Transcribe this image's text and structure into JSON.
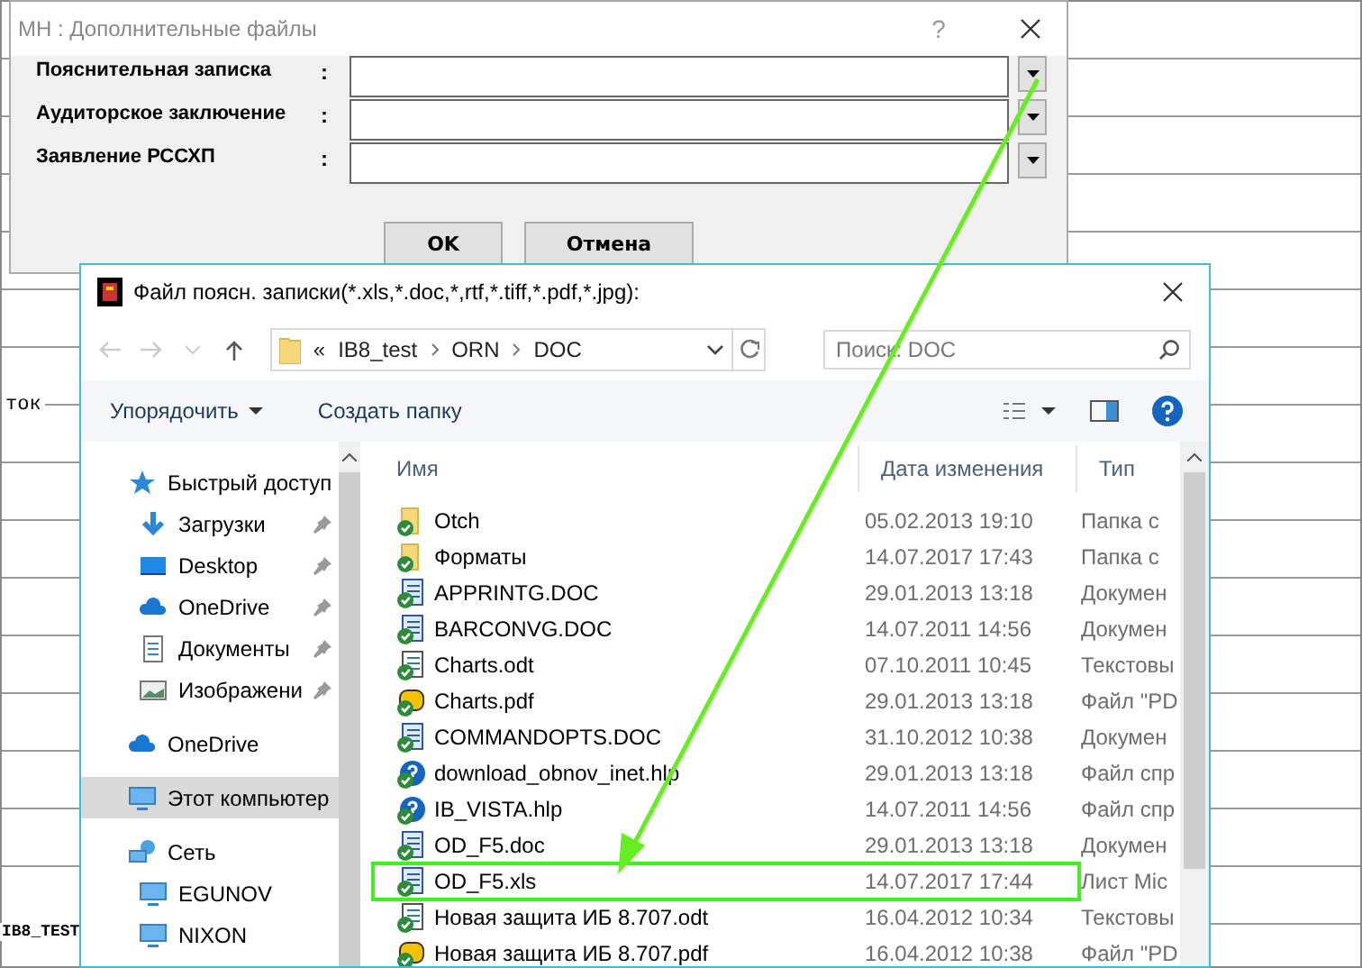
{
  "background_window": {
    "texts": [
      "ток",
      "IB8_TEST"
    ]
  },
  "dialog": {
    "title": "МН : Дополнительные файлы",
    "help": "?",
    "fields": [
      {
        "label": "Пояснительная записка",
        "separator": ":"
      },
      {
        "label": "Аудиторское заключение",
        "separator": ":"
      },
      {
        "label": "Заявление РССХП",
        "separator": ":"
      }
    ],
    "buttons": [
      {
        "label": "OK"
      },
      {
        "label": "Отмена"
      }
    ]
  },
  "file_dialog": {
    "title": "Файл поясн. записки(*.xls,*.doc,*,rtf,*.tiff,*.pdf,*.jpg):",
    "breadcrumb": {
      "overflow": "«",
      "segments": [
        "IB8_test",
        "ORN",
        "DOC"
      ]
    },
    "search": {
      "placeholder": "Поиск: DOC"
    },
    "toolbar": {
      "organize": "Упорядочить",
      "new_folder": "Создать папку"
    },
    "sidebar": [
      {
        "label": "Быстрый доступ",
        "kind": "star",
        "selected": false,
        "children": [
          {
            "label": "Загрузки",
            "kind": "download",
            "pinned": true,
            "selected": false
          },
          {
            "label": "Desktop",
            "kind": "desktop",
            "pinned": true,
            "selected": false
          },
          {
            "label": "OneDrive",
            "kind": "cloud",
            "pinned": true,
            "selected": false
          },
          {
            "label": "Документы",
            "kind": "document",
            "pinned": true,
            "selected": false
          },
          {
            "label": "Изображени",
            "kind": "image",
            "pinned": true,
            "selected": false
          }
        ]
      },
      {
        "label": "OneDrive",
        "kind": "cloud",
        "selected": false
      },
      {
        "label": "Этот компьютер",
        "kind": "computer",
        "selected": true
      },
      {
        "label": "Сеть",
        "kind": "network",
        "selected": false,
        "children": [
          {
            "label": "EGUNOV",
            "kind": "computer",
            "pinned": false,
            "selected": false
          },
          {
            "label": "NIXON",
            "kind": "computer",
            "pinned": false,
            "selected": false
          }
        ]
      }
    ],
    "columns": [
      "Имя",
      "Дата изменения",
      "Тип"
    ],
    "rows": [
      {
        "name": "Otch",
        "date": "05.02.2013 19:10",
        "type": "Папка с",
        "kind": "folder",
        "marked": false
      },
      {
        "name": "Форматы",
        "date": "14.07.2017 17:43",
        "type": "Папка с",
        "kind": "folder",
        "marked": false
      },
      {
        "name": "APPRINTG.DOC",
        "date": "29.01.2013 13:18",
        "type": "Докумен",
        "kind": "doc",
        "marked": false
      },
      {
        "name": "BARCONVG.DOC",
        "date": "14.07.2011 14:56",
        "type": "Докумен",
        "kind": "doc",
        "marked": false
      },
      {
        "name": "Charts.odt",
        "date": "07.10.2011 10:45",
        "type": "Текстовы",
        "kind": "odt",
        "marked": false
      },
      {
        "name": "Charts.pdf",
        "date": "29.01.2013 13:18",
        "type": "Файл \"PD",
        "kind": "pdf",
        "marked": false
      },
      {
        "name": "COMMANDOPTS.DOC",
        "date": "31.10.2012 10:38",
        "type": "Докумен",
        "kind": "doc",
        "marked": false
      },
      {
        "name": "download_obnov_inet.hlp",
        "date": "29.01.2013 13:18",
        "type": "Файл спр",
        "kind": "help",
        "marked": false
      },
      {
        "name": "IB_VISTA.hlp",
        "date": "14.07.2011 14:56",
        "type": "Файл спр",
        "kind": "help",
        "marked": false
      },
      {
        "name": "OD_F5.doc",
        "date": "29.01.2013 13:18",
        "type": "Докумен",
        "kind": "doc",
        "marked": false
      },
      {
        "name": "OD_F5.xls",
        "date": "14.07.2017 17:44",
        "type": "Лист Mic",
        "kind": "doc",
        "marked": true
      },
      {
        "name": "Новая защита ИБ 8.707.odt",
        "date": "16.04.2012 10:34",
        "type": "Текстовы",
        "kind": "odt",
        "marked": false
      },
      {
        "name": "Новая защита ИБ 8.707.pdf",
        "date": "16.04.2012 10:38",
        "type": "Файл \"PD",
        "kind": "pdf",
        "marked": false
      }
    ]
  }
}
